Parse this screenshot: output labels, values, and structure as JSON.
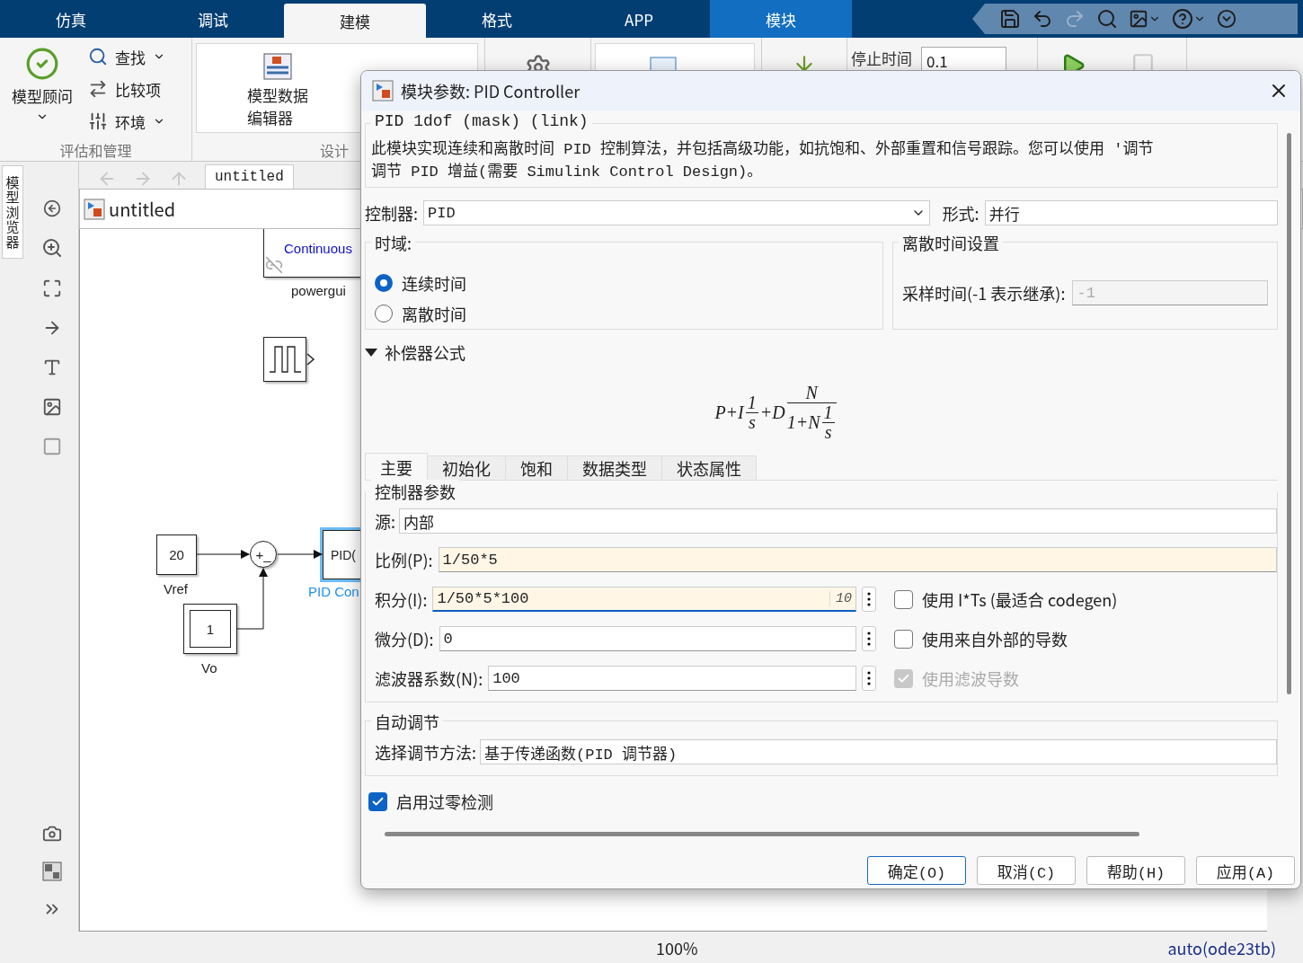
{
  "app_tabs": [
    {
      "label": "仿真",
      "selected": false,
      "contextual": false
    },
    {
      "label": "调试",
      "selected": false,
      "contextual": false
    },
    {
      "label": "建模",
      "selected": true,
      "contextual": false
    },
    {
      "label": "格式",
      "selected": false,
      "contextual": false
    },
    {
      "label": "APP",
      "selected": false,
      "contextual": false
    },
    {
      "label": "模块",
      "selected": false,
      "contextual": true
    }
  ],
  "ribbon": {
    "evaluate_group": {
      "label": "评估和管理",
      "advisor": "模型顾问",
      "items": [
        {
          "label": "查找",
          "kind": "find",
          "dropdown": true
        },
        {
          "label": "比较项",
          "kind": "compare",
          "dropdown": false
        },
        {
          "label": "环境",
          "kind": "environment",
          "dropdown": true
        }
      ]
    },
    "design_group": {
      "label": "设计",
      "data_editor": [
        "模型数据",
        "编辑器"
      ]
    },
    "stop_time": {
      "label": "停止时间",
      "value": "0.1"
    }
  },
  "model_browser_tab": "模型浏览器",
  "breadcrumb_tab": "untitled",
  "address": "untitled",
  "diagram": {
    "powergui": {
      "text": "Continuous",
      "label": "powergui"
    },
    "vref": {
      "value": "20",
      "label": "Vref"
    },
    "sum": {
      "signs": "+_"
    },
    "vo": {
      "value": "1",
      "label": "Vo"
    },
    "pid": {
      "text": "PID(",
      "label": "PID Con",
      "selected": true
    }
  },
  "status_bar": {
    "zoom": "100%",
    "solver": "auto(ode23tb)"
  },
  "dialog": {
    "title": "模块参数: PID Controller",
    "mask_title": "PID 1dof (mask) (link)",
    "description": [
      "此模块实现连续和离散时间 PID 控制算法，并包括高级功能，如抗饱和、外部重置和信号跟踪。您可以使用 '调节",
      "调节 PID 增益(需要 Simulink Control Design)。"
    ],
    "controller": {
      "label": "控制器:",
      "value": "PID"
    },
    "form": {
      "label": "形式:",
      "value": "并行"
    },
    "time_domain": {
      "label": "时域:",
      "options": [
        {
          "label": "连续时间",
          "selected": true
        },
        {
          "label": "离散时间",
          "selected": false
        }
      ]
    },
    "discrete_settings": {
      "title": "离散时间设置",
      "label": "采样时间(-1 表示继承):",
      "value": "-1",
      "disabled": true
    },
    "compensator": {
      "label": "补偿器公式",
      "expanded": true,
      "formula": [
        {
          "kind": "text",
          "text": "P+I"
        },
        {
          "kind": "frac",
          "num": [
            {
              "kind": "text",
              "text": "1"
            }
          ],
          "den": [
            {
              "kind": "text",
              "text": "s"
            }
          ]
        },
        {
          "kind": "text",
          "text": "+D"
        },
        {
          "kind": "frac",
          "num": [
            {
              "kind": "text",
              "text": "N"
            }
          ],
          "den": [
            {
              "kind": "text",
              "text": "1+N"
            },
            {
              "kind": "frac",
              "num": [
                {
                  "kind": "text",
                  "text": "1"
                }
              ],
              "den": [
                {
                  "kind": "text",
                  "text": "s"
                }
              ]
            }
          ]
        }
      ]
    },
    "tabs": [
      {
        "label": "主要",
        "selected": true
      },
      {
        "label": "初始化",
        "selected": false
      },
      {
        "label": "饱和",
        "selected": false
      },
      {
        "label": "数据类型",
        "selected": false
      },
      {
        "label": "状态属性",
        "selected": false
      }
    ],
    "params": {
      "title": "控制器参数",
      "source": {
        "label": "源:",
        "value": "内部"
      },
      "rows": [
        {
          "kind": "wide",
          "label": "比例(P):",
          "value": "1/50*5",
          "highlighted": true,
          "focused": false
        },
        {
          "kind": "option",
          "label": "积分(I):",
          "value": "1/50*5*100",
          "highlighted": true,
          "focused": true,
          "hint": "10",
          "option": {
            "label": "使用 I*Ts (最适合 codegen)",
            "checked": false,
            "disabled": false
          }
        },
        {
          "kind": "option",
          "label": "微分(D):",
          "value": "0",
          "highlighted": false,
          "focused": false,
          "option": {
            "label": "使用来自外部的导数",
            "checked": false,
            "disabled": false
          }
        },
        {
          "kind": "option",
          "label": "滤波器系数(N):",
          "value": "100",
          "highlighted": false,
          "focused": false,
          "option": {
            "label": "使用滤波导数",
            "checked": true,
            "disabled": true
          }
        }
      ]
    },
    "autotune": {
      "title": "自动调节",
      "label": "选择调节方法:",
      "value": "基于传递函数(PID 调节器)"
    },
    "zero_crossing": {
      "label": "启用过零检测",
      "checked": true
    },
    "buttons": [
      {
        "label": "确定(O)",
        "default": true
      },
      {
        "label": "取消(C)",
        "default": false
      },
      {
        "label": "帮助(H)",
        "default": false
      },
      {
        "label": "应用(A)",
        "default": false
      }
    ]
  }
}
